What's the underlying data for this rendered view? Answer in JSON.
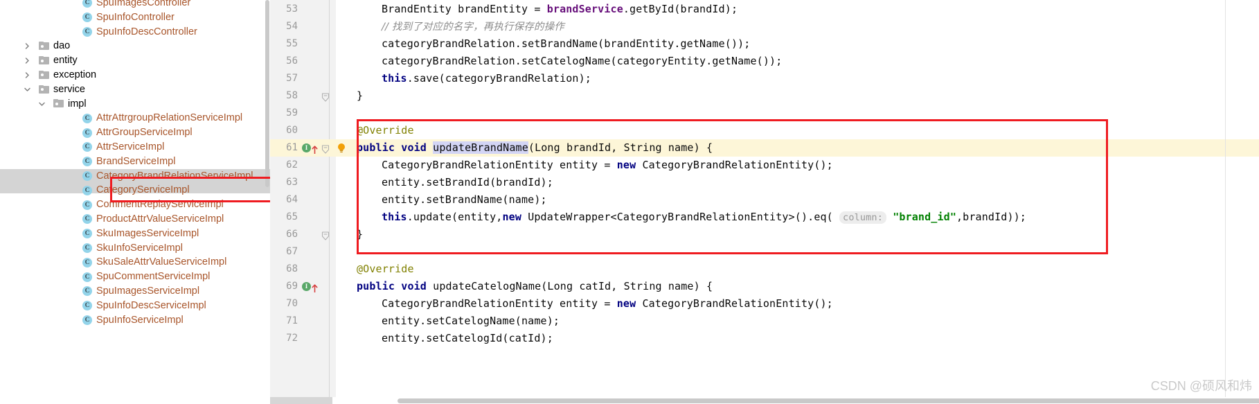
{
  "project_tree": {
    "items": [
      {
        "indent": 5,
        "type": "class",
        "label": "SpuImagesController",
        "arrow": ""
      },
      {
        "indent": 5,
        "type": "class",
        "label": "SpuInfoController",
        "arrow": ""
      },
      {
        "indent": 5,
        "type": "class",
        "label": "SpuInfoDescController",
        "arrow": ""
      },
      {
        "indent": 2,
        "type": "folder",
        "label": "dao",
        "arrow": "collapsed"
      },
      {
        "indent": 2,
        "type": "folder",
        "label": "entity",
        "arrow": "collapsed"
      },
      {
        "indent": 2,
        "type": "folder",
        "label": "exception",
        "arrow": "collapsed"
      },
      {
        "indent": 2,
        "type": "folder",
        "label": "service",
        "arrow": "expanded"
      },
      {
        "indent": 3,
        "type": "folder",
        "label": "impl",
        "arrow": "expanded"
      },
      {
        "indent": 5,
        "type": "class",
        "label": "AttrAttrgroupRelationServiceImpl",
        "arrow": ""
      },
      {
        "indent": 5,
        "type": "class",
        "label": "AttrGroupServiceImpl",
        "arrow": ""
      },
      {
        "indent": 5,
        "type": "class",
        "label": "AttrServiceImpl",
        "arrow": ""
      },
      {
        "indent": 5,
        "type": "class",
        "label": "BrandServiceImpl",
        "arrow": ""
      },
      {
        "indent": 5,
        "type": "class",
        "label": "CategoryBrandRelationServiceImpl",
        "arrow": "",
        "selected": true
      },
      {
        "indent": 5,
        "type": "class",
        "label": "CategoryServiceImpl",
        "arrow": ""
      },
      {
        "indent": 5,
        "type": "class",
        "label": "CommentReplayServiceImpl",
        "arrow": ""
      },
      {
        "indent": 5,
        "type": "class",
        "label": "ProductAttrValueServiceImpl",
        "arrow": ""
      },
      {
        "indent": 5,
        "type": "class",
        "label": "SkuImagesServiceImpl",
        "arrow": ""
      },
      {
        "indent": 5,
        "type": "class",
        "label": "SkuInfoServiceImpl",
        "arrow": ""
      },
      {
        "indent": 5,
        "type": "class",
        "label": "SkuSaleAttrValueServiceImpl",
        "arrow": ""
      },
      {
        "indent": 5,
        "type": "class",
        "label": "SpuCommentServiceImpl",
        "arrow": ""
      },
      {
        "indent": 5,
        "type": "class",
        "label": "SpuImagesServiceImpl",
        "arrow": ""
      },
      {
        "indent": 5,
        "type": "class",
        "label": "SpuInfoDescServiceImpl",
        "arrow": ""
      },
      {
        "indent": 5,
        "type": "class",
        "label": "SpuInfoServiceImpl",
        "arrow": ""
      }
    ],
    "class_badge_letter": "C"
  },
  "editor": {
    "lines": [
      {
        "num": "53",
        "indent": 1,
        "tokens": [
          {
            "t": "plain",
            "v": "BrandEntity brandEntity = "
          },
          {
            "t": "fld",
            "v": "brandService"
          },
          {
            "t": "plain",
            "v": ".getById(brandId);"
          }
        ]
      },
      {
        "num": "54",
        "indent": 1,
        "tokens": [
          {
            "t": "cmt",
            "v": "// 找到了对应的名字，再执行保存的操作"
          }
        ]
      },
      {
        "num": "55",
        "indent": 1,
        "tokens": [
          {
            "t": "plain",
            "v": "categoryBrandRelation.setBrandName(brandEntity.getName());"
          }
        ]
      },
      {
        "num": "56",
        "indent": 1,
        "tokens": [
          {
            "t": "plain",
            "v": "categoryBrandRelation.setCatelogName(categoryEntity.getName());"
          }
        ]
      },
      {
        "num": "57",
        "indent": 1,
        "tokens": [
          {
            "t": "kw",
            "v": "this"
          },
          {
            "t": "plain",
            "v": ".save(categoryBrandRelation);"
          }
        ]
      },
      {
        "num": "58",
        "indent": 0,
        "tokens": [
          {
            "t": "plain",
            "v": "}"
          }
        ],
        "fold": true
      },
      {
        "num": "59",
        "indent": 0,
        "tokens": []
      },
      {
        "num": "60",
        "indent": 0,
        "tokens": [
          {
            "t": "ann",
            "v": "@Override"
          }
        ]
      },
      {
        "num": "61",
        "indent": 0,
        "highlight": true,
        "impl_marker": true,
        "bulb": true,
        "fold": true,
        "tokens": [
          {
            "t": "kw",
            "v": "public void "
          },
          {
            "t": "caret",
            "v": ""
          },
          {
            "t": "sel",
            "v": "updateBrandName"
          },
          {
            "t": "plain",
            "v": "(Long brandId, String name) {"
          }
        ]
      },
      {
        "num": "62",
        "indent": 1,
        "tokens": [
          {
            "t": "plain",
            "v": "CategoryBrandRelationEntity entity = "
          },
          {
            "t": "kw",
            "v": "new "
          },
          {
            "t": "plain",
            "v": "CategoryBrandRelationEntity();"
          }
        ]
      },
      {
        "num": "63",
        "indent": 1,
        "tokens": [
          {
            "t": "plain",
            "v": "entity.setBrandId(brandId);"
          }
        ]
      },
      {
        "num": "64",
        "indent": 1,
        "tokens": [
          {
            "t": "plain",
            "v": "entity.setBrandName(name);"
          }
        ]
      },
      {
        "num": "65",
        "indent": 1,
        "tokens": [
          {
            "t": "kw",
            "v": "this"
          },
          {
            "t": "plain",
            "v": ".update(entity,"
          },
          {
            "t": "kw",
            "v": "new "
          },
          {
            "t": "plain",
            "v": "UpdateWrapper<CategoryBrandRelationEntity>().eq( "
          },
          {
            "t": "hint",
            "v": "column:"
          },
          {
            "t": "plain",
            "v": " "
          },
          {
            "t": "str",
            "v": "\"brand_id\""
          },
          {
            "t": "plain",
            "v": ",brandId));"
          }
        ]
      },
      {
        "num": "66",
        "indent": 0,
        "tokens": [
          {
            "t": "plain",
            "v": "}"
          }
        ],
        "fold": true
      },
      {
        "num": "67",
        "indent": 0,
        "tokens": []
      },
      {
        "num": "68",
        "indent": 0,
        "tokens": [
          {
            "t": "ann",
            "v": "@Override"
          }
        ]
      },
      {
        "num": "69",
        "indent": 0,
        "impl_marker": true,
        "tokens": [
          {
            "t": "kw",
            "v": "public void "
          },
          {
            "t": "plain",
            "v": "updateCatelogName(Long catId, String name) {"
          }
        ]
      },
      {
        "num": "70",
        "indent": 1,
        "tokens": [
          {
            "t": "plain",
            "v": "CategoryBrandRelationEntity entity = "
          },
          {
            "t": "kw",
            "v": "new "
          },
          {
            "t": "plain",
            "v": "CategoryBrandRelationEntity();"
          }
        ]
      },
      {
        "num": "71",
        "indent": 1,
        "tokens": [
          {
            "t": "plain",
            "v": "entity.setCatelogName(name);"
          }
        ]
      },
      {
        "num": "72",
        "indent": 1,
        "tokens": [
          {
            "t": "plain",
            "v": "entity.setCatelogId(catId);"
          }
        ]
      }
    ]
  },
  "annotations": {
    "highlight_color": "#ef1b20",
    "tree_box_target": "CategoryBrandRelationServiceImpl",
    "code_box_target": "updateBrandName method"
  },
  "watermark": {
    "text": "CSDN @硕风和炜"
  }
}
